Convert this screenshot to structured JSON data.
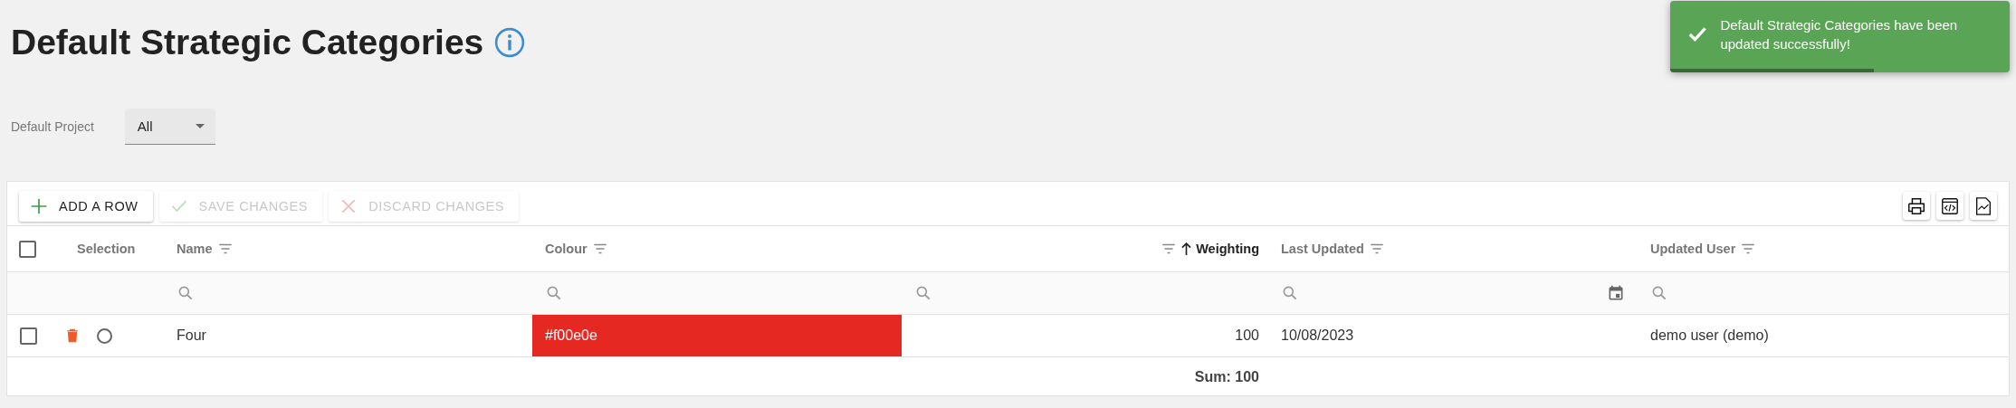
{
  "title": "Default Strategic Categories",
  "project_filter": {
    "label": "Default Project",
    "value": "All"
  },
  "toast": {
    "message": "Default Strategic Categories have been updated successfully!",
    "level": 0.6
  },
  "toolbar": [
    {
      "label": "ADD A ROW",
      "kind": "add",
      "disabled": false
    },
    {
      "label": "SAVE CHANGES",
      "kind": "save",
      "disabled": true
    },
    {
      "label": "DISCARD CHANGES",
      "kind": "discard",
      "disabled": true
    }
  ],
  "export_buttons": [
    {
      "kind": "print"
    },
    {
      "kind": "code"
    },
    {
      "kind": "chart"
    }
  ],
  "header_checkbox": {
    "checked": false
  },
  "columns": [
    {
      "label": "Selection",
      "kind": "plain",
      "sorted": false
    },
    {
      "label": "Name",
      "kind": "text",
      "filter": {
        "kind": "text"
      },
      "sorted": false
    },
    {
      "label": "Colour",
      "kind": "text",
      "filter": {
        "kind": "text"
      },
      "sorted": false
    },
    {
      "label": "Weighting",
      "kind": "number",
      "filter": {
        "kind": "text"
      },
      "sorted": true
    },
    {
      "label": "Last Updated",
      "kind": "text",
      "filter": {
        "kind": "date"
      },
      "sorted": false
    },
    {
      "label": "Updated User",
      "kind": "text",
      "filter": {
        "kind": "text"
      },
      "sorted": false
    }
  ],
  "rows": [
    {
      "checked": false,
      "selected": false,
      "name": "Four",
      "colour": "#f00e0e",
      "color": "#e62822",
      "weighting": "100",
      "last_updated": "10/08/2023",
      "updated_user": "demo user (demo)"
    }
  ],
  "footer": {
    "weighting": "Sum: 100"
  }
}
